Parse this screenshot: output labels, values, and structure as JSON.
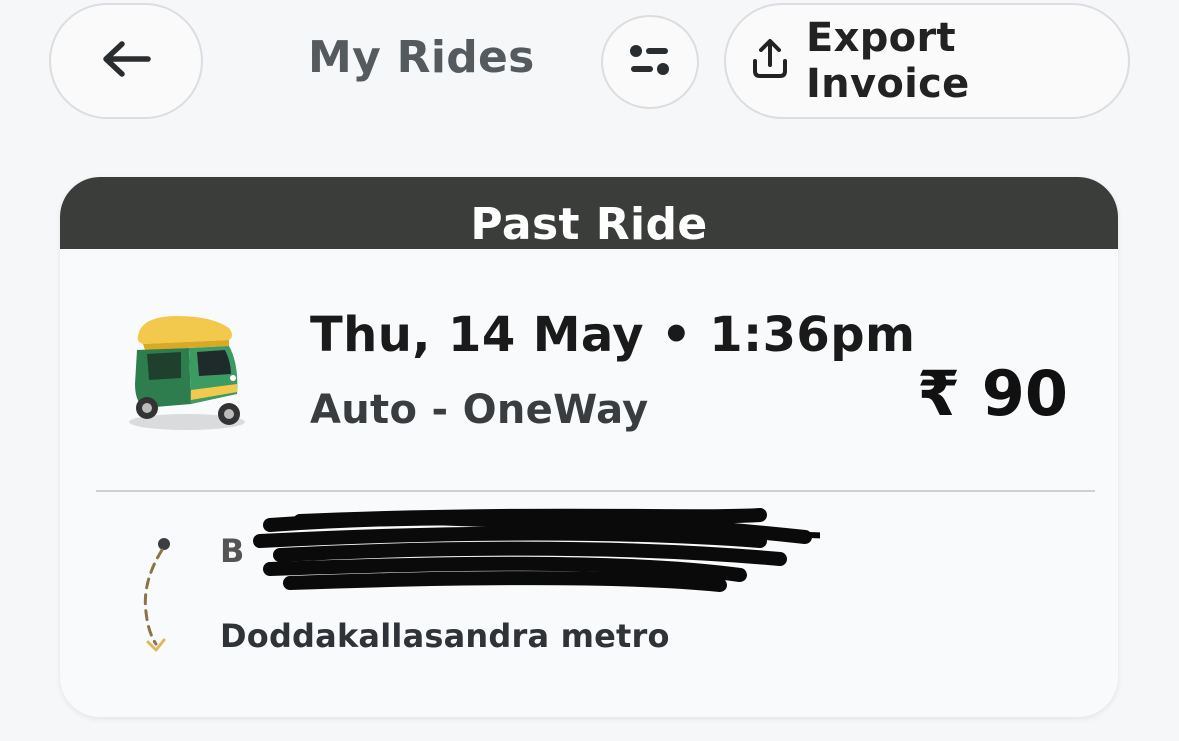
{
  "header": {
    "title": "My Rides",
    "export_label": "Export Invoice",
    "icons": {
      "back": "arrow-left-icon",
      "filter": "filter-icon",
      "export": "upload-icon"
    }
  },
  "ride_card": {
    "status_banner": "Past Ride",
    "vehicle_icon": "auto-rickshaw-icon",
    "datetime": "Thu, 14 May • 1:36pm",
    "ride_type": "Auto - OneWay",
    "fare": "₹ 90",
    "pickup": "B",
    "drop": "Doddakallasandra metro"
  },
  "colors": {
    "background": "#f6f7f9",
    "banner": "#3b3d3a",
    "route_accent": "#e0b85a",
    "auto_yellow": "#f2c94c",
    "auto_green": "#2e7d4f"
  }
}
